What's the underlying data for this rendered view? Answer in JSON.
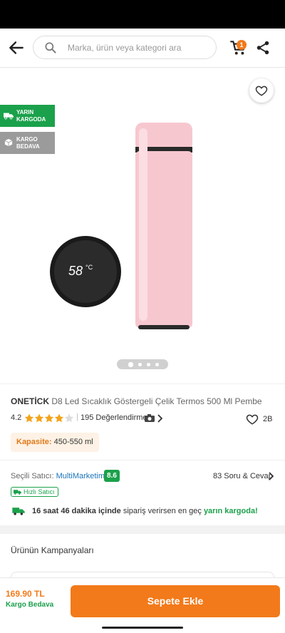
{
  "header": {
    "search_placeholder": "Marka, ürün veya kategori ara",
    "cart_count": "1"
  },
  "badges": {
    "next_day": "YARIN\nKARGODA",
    "free_shipping": "KARGO\nBEDAVA"
  },
  "gallery": {
    "image_count": 4,
    "active_index": 0
  },
  "product": {
    "brand": "ONETİCK",
    "name": "D8 Led Sıcaklık Göstergeli Çelik Termos 500 Ml Pembe",
    "rating": "4.2",
    "rating_stars": 4.2,
    "reviews": "195 Değerlendirme",
    "likes": "2B",
    "capacity_label": "Kapasite:",
    "capacity_value": "450-550 ml"
  },
  "seller": {
    "label": "Seçili Satıcı:",
    "name": "MultiMarketim",
    "score": "8.6",
    "qa": "83 Soru & Cevap",
    "fast_label": "Hızlı Satıcı"
  },
  "shipping": {
    "countdown": "16 saat 46 dakika içinde",
    "middle": "sipariş verirsen en geç",
    "highlight": "yarın kargoda!"
  },
  "campaigns": {
    "title": "Ürünün Kampanyaları"
  },
  "footer": {
    "price": "169.90 TL",
    "free_shipping": "Kargo Bedava",
    "add_to_cart": "Sepete Ekle"
  },
  "colors": {
    "accent": "#f27a1a",
    "green": "#1ba14b",
    "link": "#1b75bb",
    "product_pink": "#f7c7cf"
  }
}
